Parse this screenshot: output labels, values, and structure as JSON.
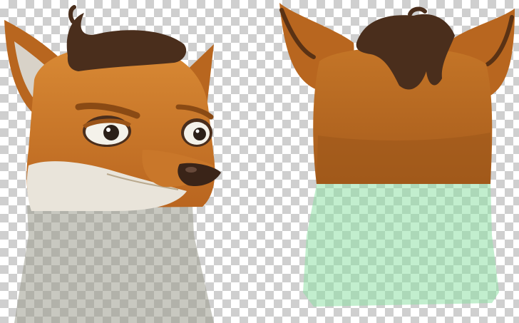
{
  "colors": {
    "checker_light": "#ffffff",
    "checker_dark": "#cfcfcf",
    "fur_main": "#c9772a",
    "fur_light": "#e0923c",
    "fur_shadow": "#9a5418",
    "hair": "#4a2e1c",
    "ear_inner": "#d8d2c8",
    "muzzle": "#e9e4da",
    "eye_white": "#f4f2ea",
    "pupil": "#2b2018",
    "nose": "#3a2418",
    "body_front": "#9a9a8c",
    "body_back": "#8fe0a6"
  },
  "figures": [
    {
      "name": "fox-head-front",
      "icon": "fox-face-icon"
    },
    {
      "name": "fox-head-back",
      "icon": "fox-back-of-head-icon"
    }
  ]
}
